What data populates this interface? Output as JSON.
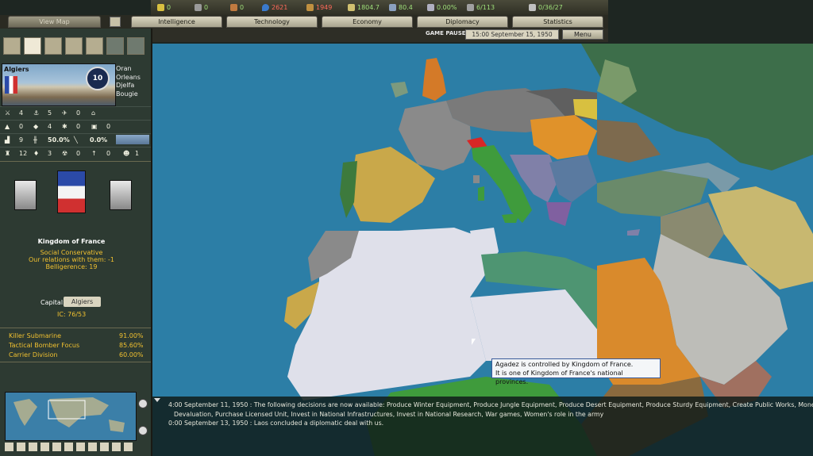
{
  "resources": {
    "energy": "0",
    "metal": "0",
    "rare": "0",
    "oil": "2621",
    "supplies": "1949",
    "money": "1804.7",
    "manpower": "80.4",
    "transport": "0.00%",
    "escorts": "6/113",
    "convoys": "0/36/27"
  },
  "tabs": {
    "viewmap": "View Map",
    "intelligence": "Intelligence",
    "technology": "Technology",
    "economy": "Economy",
    "diplomacy": "Diplomacy",
    "statistics": "Statistics"
  },
  "status": {
    "paused": "GAME PAUSED",
    "datetime": "15:00 September 15, 1950",
    "menu": "Menu"
  },
  "province": {
    "name": "Algiers",
    "badge": "10",
    "neighbors": [
      "Oran",
      "Orleans",
      "Djelfa",
      "Bougie"
    ],
    "stats": {
      "r1": [
        "4",
        "5",
        "0"
      ],
      "r2": [
        "0",
        "4",
        "0",
        "0"
      ],
      "r3": [
        "9",
        "50.0%",
        "0.0%"
      ],
      "r4": [
        "12",
        "3",
        "0",
        "0",
        "1"
      ]
    }
  },
  "nation": {
    "name": "Kingdom of France",
    "ideology": "Social Conservative",
    "relations": "Our relations with them: -1",
    "belligerence": "Belligerence: 19",
    "capital_label": "Capital:",
    "capital": "Algiers",
    "ic": "IC: 76/53"
  },
  "research": [
    {
      "name": "Killer Submarine",
      "pct": "91.00%"
    },
    {
      "name": "Tactical Bomber Focus",
      "pct": "85.60%"
    },
    {
      "name": "Carrier Division",
      "pct": "60.00%"
    }
  ],
  "tooltip": {
    "line1": "Agadez is controlled by Kingdom of France.",
    "line2": "It is one of Kingdom of France's national provinces."
  },
  "log": {
    "line1": "4:00 September 11, 1950 : The following decisions are now available: Produce Winter Equipment, Produce Jungle Equipment, Produce Desert Equipment, Produce Sturdy Equipment, Create Public Works, Money",
    "line2": "Devaluation, Purchase Licensed Unit, Invest in National Infrastructures, Invest in National Research, War games, Women's role in the army",
    "line3": "0:00 September 13, 1950 : Laos concluded a diplomatic deal with us."
  },
  "colors": {
    "sea": "#2c7ea6",
    "france": "#dfe0ea",
    "spain": "#c9a84a",
    "italy": "#3f9b3c",
    "libya": "#4e9572",
    "egypt": "#d98a2c",
    "germany": "#7a7a7a",
    "arabia": "#bdbdb8"
  }
}
